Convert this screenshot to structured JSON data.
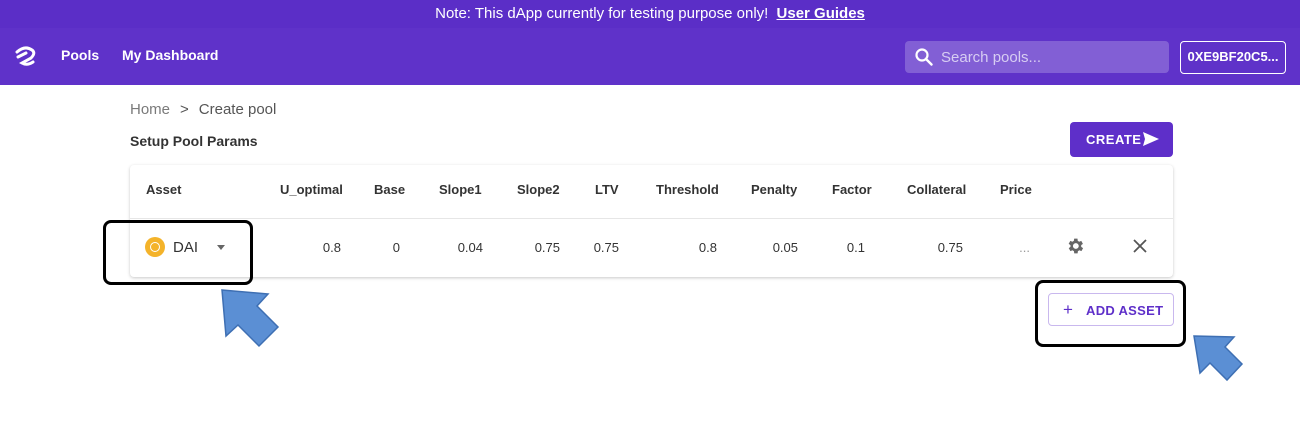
{
  "banner": {
    "text": "Note: This dApp currently for testing purpose only!",
    "link": "User Guides"
  },
  "nav": {
    "logo": "tokenize-logo-icon",
    "links": [
      "Pools",
      "My Dashboard"
    ],
    "search_placeholder": "Search pools...",
    "wallet": "0XE9BF20C5..."
  },
  "breadcrumb": {
    "home": "Home",
    "separator": ">",
    "current": "Create pool"
  },
  "section_title": "Setup Pool Params",
  "create_button": "CREATE",
  "table": {
    "headers": [
      "Asset",
      "U_optimal",
      "Base",
      "Slope1",
      "Slope2",
      "LTV",
      "Threshold",
      "Penalty",
      "Factor",
      "Collateral",
      "Price"
    ],
    "row": {
      "asset": "DAI",
      "u_optimal": "0.8",
      "base": "0",
      "slope1": "0.04",
      "slope2": "0.75",
      "ltv": "0.75",
      "threshold": "0.8",
      "penalty": "0.05",
      "factor": "0.1",
      "collateral": "0.75",
      "price": "..."
    }
  },
  "add_asset_button": "ADD ASSET",
  "colors": {
    "brand": "#5f32c9",
    "banner": "#5b2ec7",
    "coin": "#f4b32a",
    "arrow": "#5b8fd4"
  }
}
